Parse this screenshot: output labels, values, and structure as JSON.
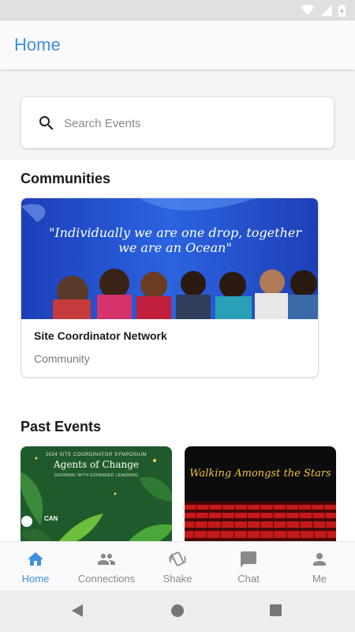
{
  "app_bar": {
    "title": "Home"
  },
  "search": {
    "placeholder": "Search Events",
    "value": ""
  },
  "communities": {
    "heading": "Communities",
    "items": [
      {
        "banner_quote": "\"Individually we are one drop, together we are an Ocean\"",
        "name": "Site Coordinator Network",
        "type": "Community"
      }
    ]
  },
  "past_events": {
    "heading": "Past Events",
    "items": [
      {
        "small_text": "2024 SITE COORDINATOR SYMPOSIUM",
        "title": "Agents of Change",
        "subtitle": "GROWING WITH EXPANDED LEARNING",
        "logo_text": "CAN"
      },
      {
        "title": "Walking Amongst the Stars"
      }
    ]
  },
  "bottom_nav": {
    "active": "Home",
    "items": [
      {
        "label": "Home",
        "icon": "home-icon"
      },
      {
        "label": "Connections",
        "icon": "people-icon"
      },
      {
        "label": "Shake",
        "icon": "shake-icon"
      },
      {
        "label": "Chat",
        "icon": "chat-icon"
      },
      {
        "label": "Me",
        "icon": "person-icon"
      }
    ]
  },
  "colors": {
    "accent": "#3f8fe0",
    "inactive": "#8a8a8a"
  }
}
